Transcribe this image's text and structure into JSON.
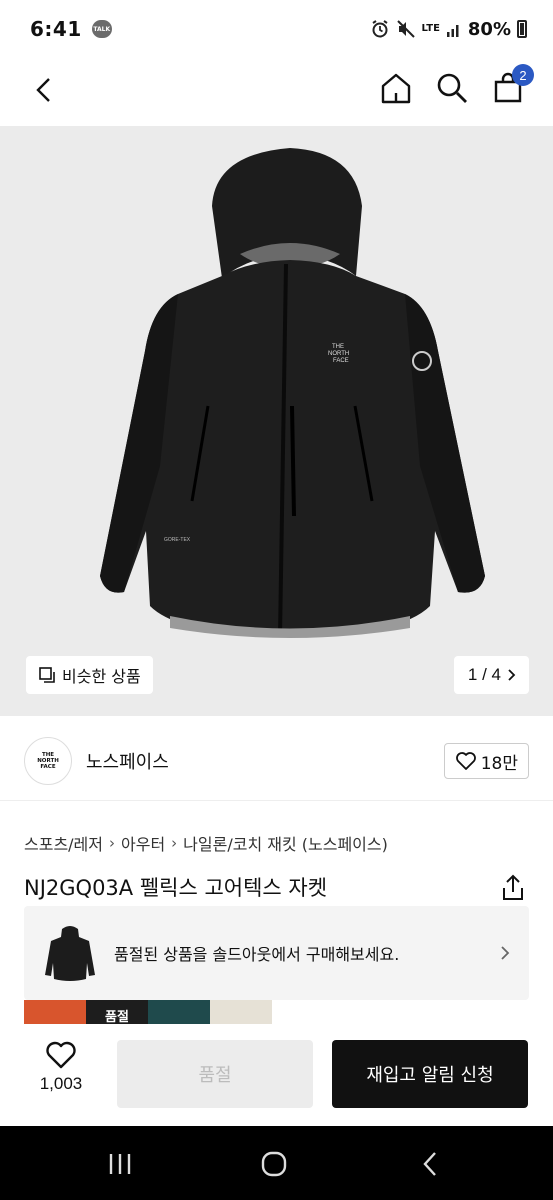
{
  "status_bar": {
    "time": "6:41",
    "talk_badge": "TALK",
    "network": "LTE",
    "battery": "80%",
    "icons": [
      "alarm-icon",
      "mute-icon",
      "signal-icon",
      "battery-icon"
    ]
  },
  "header": {
    "icons": [
      "back-icon",
      "home-icon",
      "search-icon",
      "cart-icon"
    ],
    "cart_count": "2"
  },
  "gallery": {
    "similar_label": "비슷한 상품",
    "page_indicator": "1 / 4",
    "jacket_logo": [
      "THE",
      "NORTH",
      "FACE"
    ],
    "goretex_tag": "GORE-TEX"
  },
  "brand": {
    "logo_lines": [
      "THE",
      "NORTH",
      "FACE"
    ],
    "name": "노스페이스",
    "likes": "18만"
  },
  "breadcrumb": [
    "스포츠/레저",
    "아우터",
    "나일론/코치 재킷 (노스페이스)"
  ],
  "product": {
    "title": "NJ2GQ03A 펠릭스 고어텍스 자켓"
  },
  "soldout_banner": {
    "text": "품절된 상품을 솔드아웃에서 구매해보세요."
  },
  "color_thumbs": [
    {
      "color": "#d8552d",
      "label": ""
    },
    {
      "color": "#1d1d1d",
      "label": "품절"
    },
    {
      "color": "#1f4a4c",
      "label": ""
    },
    {
      "color": "#e6e1d6",
      "label": ""
    }
  ],
  "bottom_bar": {
    "wish_count": "1,003",
    "soldout_label": "품절",
    "restock_label": "재입고 알림 신청"
  },
  "colors": {
    "accent": "#2b59c3",
    "primary_button": "#111111",
    "disabled_button": "#ececec"
  }
}
